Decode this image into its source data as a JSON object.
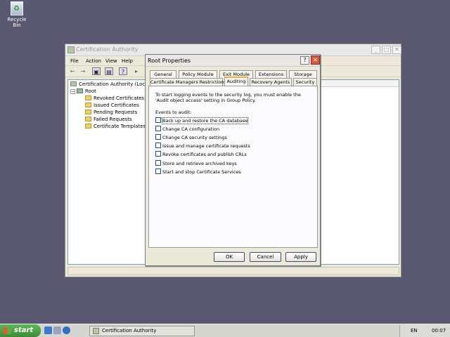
{
  "desktop": {
    "recycle_bin_label": "Recycle Bin"
  },
  "mmc": {
    "title": "Certification Authority",
    "menu": [
      "File",
      "Action",
      "View",
      "Help"
    ],
    "tree": {
      "root_label": "Certification Authority (Local)",
      "ca_label": "Root",
      "children": [
        "Revoked Certificates",
        "Issued Certificates",
        "Pending Requests",
        "Failed Requests",
        "Certificate Templates"
      ]
    }
  },
  "dialog": {
    "title": "Root Properties",
    "help_glyph": "?",
    "close_glyph": "✕",
    "tabs_row1": [
      "General",
      "Policy Module",
      "Exit Module",
      "Extensions",
      "Storage"
    ],
    "tabs_row2": [
      "Certificate Managers Restrictions",
      "Auditing",
      "Recovery Agents",
      "Security"
    ],
    "active_tab": "Auditing",
    "info_text": "To start logging events to the security log, you must enable the 'Audit object access' setting in Group Policy.",
    "events_label": "Events to audit:",
    "events": [
      {
        "label": "Back up and restore the CA database",
        "checked": false
      },
      {
        "label": "Change CA configuration",
        "checked": false
      },
      {
        "label": "Change CA security settings",
        "checked": false
      },
      {
        "label": "Issue and manage certificate requests",
        "checked": false
      },
      {
        "label": "Revoke certificates and publish CRLs",
        "checked": false
      },
      {
        "label": "Store and retrieve archived keys",
        "checked": false
      },
      {
        "label": "Start and stop Certificate Services",
        "checked": false
      }
    ],
    "buttons": {
      "ok": "OK",
      "cancel": "Cancel",
      "apply": "Apply"
    }
  },
  "taskbar": {
    "start_label": "start",
    "task_label": "Certification Authority",
    "language": "EN",
    "clock": "00:07"
  }
}
